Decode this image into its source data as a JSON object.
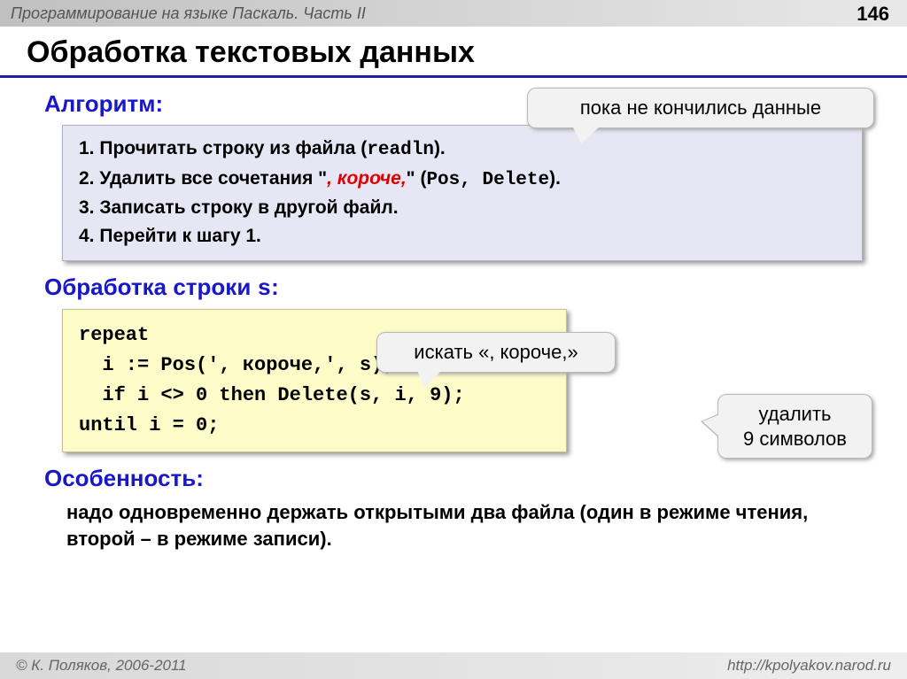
{
  "header": {
    "breadcrumb": "Программирование на языке Паскаль. Часть II",
    "page_number": "146"
  },
  "title": "Обработка текстовых данных",
  "algorithm": {
    "heading": "Алгоритм:",
    "step1_a": "1. Прочитать строку из файла (",
    "step1_b": "readln",
    "step1_c": ").",
    "step2_a": "2. Удалить все сочетания \"",
    "step2_b": ", короче,",
    "step2_c": "\" (",
    "step2_d": "Pos",
    "step2_e": ", ",
    "step2_f": "Delete",
    "step2_g": ").",
    "step3": "3. Записать строку в другой файл.",
    "step4": "4. Перейти к шагу 1."
  },
  "callouts": {
    "c1": "пока не кончились данные",
    "c2": "искать «, короче,»",
    "c3_l1": "удалить",
    "c3_l2": "9 символов"
  },
  "processing": {
    "heading_a": "Обработка строки ",
    "heading_b": "s",
    "heading_c": ":",
    "code": "repeat\n  i := Pos(', короче,', s);\n  if i <> 0 then Delete(s, i, 9);\nuntil i = 0;"
  },
  "feature": {
    "heading": "Особенность:",
    "text": "надо одновременно держать открытыми два файла (один в режиме чтения, второй – в режиме записи)."
  },
  "footer": {
    "copyright": "© К. Поляков, 2006-2011",
    "url": "http://kpolyakov.narod.ru"
  }
}
